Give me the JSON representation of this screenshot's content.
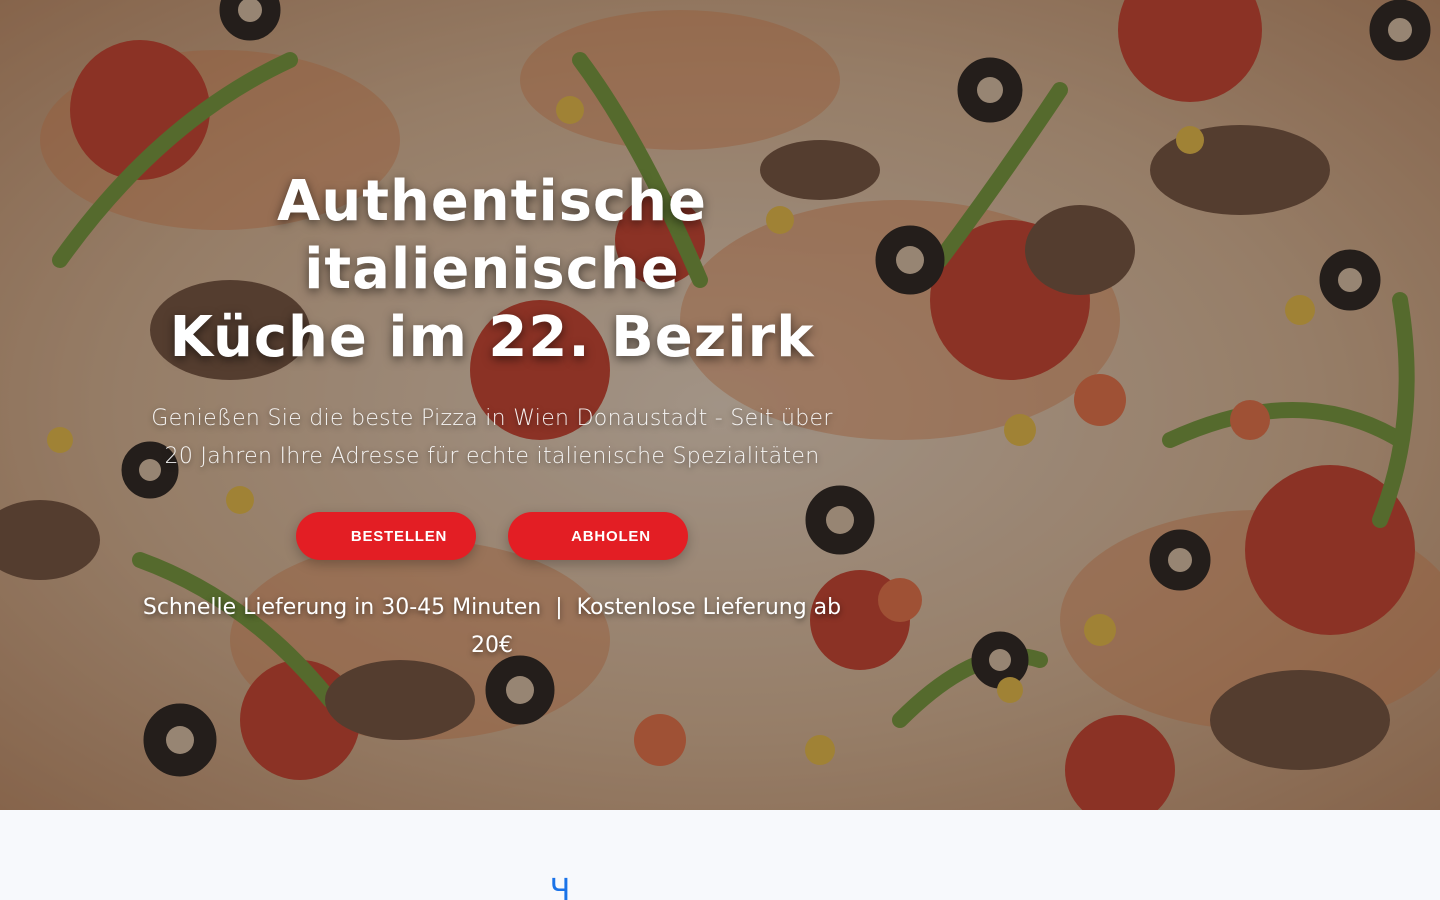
{
  "hero": {
    "title_lines": [
      "Authentische",
      "italienische",
      "Küche im 22. Bezirk"
    ],
    "subtitle_lines": [
      "Genießen Sie die beste Pizza in Wien Donaustadt - Seit über",
      "20 Jahren Ihre Adresse für echte italienische Spezialitäten"
    ],
    "buttons": [
      {
        "label": "BESTELLEN",
        "icon": "delivery-icon",
        "glyph": ""
      },
      {
        "label": "ABHOLEN",
        "icon": "store-icon",
        "glyph": ""
      }
    ],
    "features": {
      "item1_icon": "",
      "item1_text": "Schnelle Lieferung in 30-45 Minuten",
      "separator": "|",
      "item2_icon": "",
      "item2_text": "Kostenlose Lieferung ab 20€"
    }
  },
  "strip": {
    "icons": [
      {
        "name": "feature-icon-1",
        "glyph": ""
      },
      {
        "name": "feature-icon-2",
        "glyph": "Ч"
      },
      {
        "name": "feature-icon-3",
        "glyph": ""
      },
      {
        "name": "feature-icon-4",
        "glyph": ""
      }
    ]
  },
  "colors": {
    "accent_red": "#e31e24",
    "icon_blue": "#1a73e8",
    "strip_bg": "#f7f9fc"
  }
}
